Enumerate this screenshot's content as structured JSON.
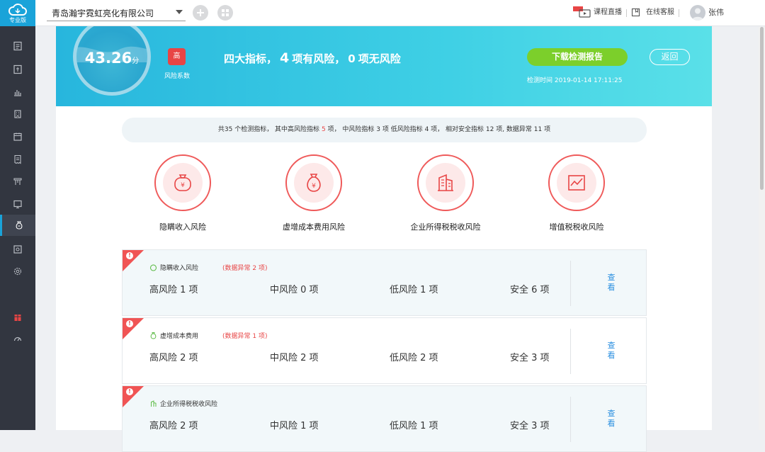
{
  "app": {
    "logo_label": "专业版"
  },
  "nav": {
    "items": [
      "report-icon",
      "ledger-icon",
      "chart-icon",
      "building-icon",
      "calendar-icon",
      "receipt-icon",
      "tools-icon",
      "monitor-icon",
      "money-bag-icon",
      "voucher-icon",
      "settings-icon",
      "gift-icon",
      "dashboard-icon"
    ]
  },
  "topbar": {
    "company": "青岛瀚宇霓虹亮化有限公司",
    "live_course": "课程直播",
    "online_service": "在线客服",
    "user_name": "张伟"
  },
  "banner": {
    "score": "43.26",
    "score_unit": "分",
    "risk_level": "高",
    "risk_label": "风险系数",
    "headline_prefix": "四大指标，",
    "risky_count": "4",
    "headline_mid": "项有风险，",
    "safe_count": "0",
    "headline_suffix": "项无风险",
    "download_label": "下载检测报告",
    "back_label": "返回",
    "check_time_label": "检测时间",
    "check_time": "2019-01-14 17:11:25"
  },
  "summary": {
    "part1": "共35 个检测指标， 其中高风险指标",
    "high_count": "5",
    "part2": "项， 中风险指标 3 项 低风险指标 4 项， 相对安全指标 12 项, 数据异常 11 项"
  },
  "categories": [
    {
      "label": "隐瞒收入风险",
      "icon": "money-bag-icon"
    },
    {
      "label": "虚增成本费用风险",
      "icon": "cost-bag-icon"
    },
    {
      "label": "企业所得税税收风险",
      "icon": "building-icon"
    },
    {
      "label": "增值税税收风险",
      "icon": "trend-chart-icon"
    }
  ],
  "cards": [
    {
      "title": "隐瞒收入风险",
      "anomaly": "(数据异常 2 项)",
      "high": "高风险 1 项",
      "mid": "中风险 0 项",
      "low": "低风险 1 项",
      "safe": "安全 6 项",
      "view": "查看"
    },
    {
      "title": "虚增成本费用",
      "anomaly": "(数据异常 1 项)",
      "high": "高风险 2 项",
      "mid": "中风险 2 项",
      "low": "低风险 2 项",
      "safe": "安全 3 项",
      "view": "查看"
    },
    {
      "title": "企业所得税税收风险",
      "anomaly": "",
      "high": "高风险 2 项",
      "mid": "中风险 1 项",
      "low": "低风险 1 项",
      "safe": "安全 3 项",
      "view": "查看"
    }
  ],
  "colors": {
    "accent": "#1aa3d9",
    "danger": "#e84545",
    "success": "#7ccf2b",
    "sidebar": "#323640"
  }
}
